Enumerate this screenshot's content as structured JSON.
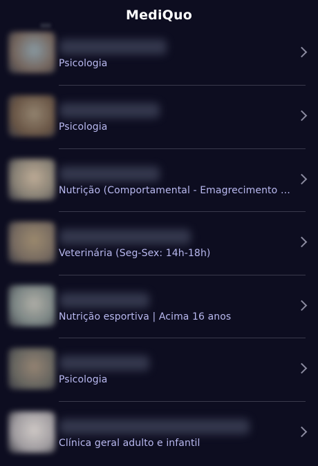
{
  "header": {
    "title": "MediQuo"
  },
  "list": {
    "items": [
      {
        "specialty": "Psicologia",
        "avatar_colors": [
          "#8fa0a8",
          "#7a6a60"
        ]
      },
      {
        "specialty": "Psicologia",
        "avatar_colors": [
          "#9a8a74",
          "#6f5a48"
        ]
      },
      {
        "specialty": "Nutrição (Comportamental - Emagrecimento -  Pa…",
        "avatar_colors": [
          "#c7b49c",
          "#8d8679"
        ]
      },
      {
        "specialty": "Veterinária (Seg-Sex: 14h-18h)",
        "avatar_colors": [
          "#a49173",
          "#7d7064"
        ]
      },
      {
        "specialty": "Nutrição esportiva | Acima 16 anos",
        "avatar_colors": [
          "#b8b7ae",
          "#7f8a88"
        ]
      },
      {
        "specialty": "Psicologia",
        "avatar_colors": [
          "#9c8a78",
          "#6b6a63"
        ]
      },
      {
        "specialty": "Clínica geral adulto e infantil",
        "avatar_colors": [
          "#d9d3cf",
          "#a7a3a6"
        ]
      }
    ]
  }
}
